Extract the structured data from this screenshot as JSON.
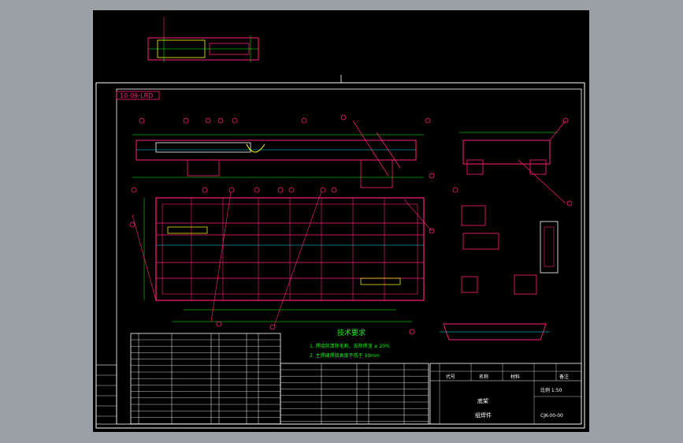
{
  "title_block": {
    "drawing_code": "10-09-LRD",
    "tech_heading": "技术要求",
    "tech_notes": [
      "1. 焊接前清除毛刺，去除焊渣 ≤ 20%",
      "2. 主焊缝焊接高度不低于 10mm"
    ],
    "scale_label": "比例 1:50",
    "part_label": "底架",
    "name_label": "组焊件",
    "drawing_number": "CJK-00-00",
    "column_headers": [
      "代号",
      "名称",
      "材料",
      "备注"
    ]
  },
  "colors": {
    "background": "#000000",
    "frame": "#ffffff",
    "structure": "#ff1f7a",
    "dimension": "#00ff00",
    "accent": "#00e5ff",
    "label_text": "#ffff00"
  }
}
